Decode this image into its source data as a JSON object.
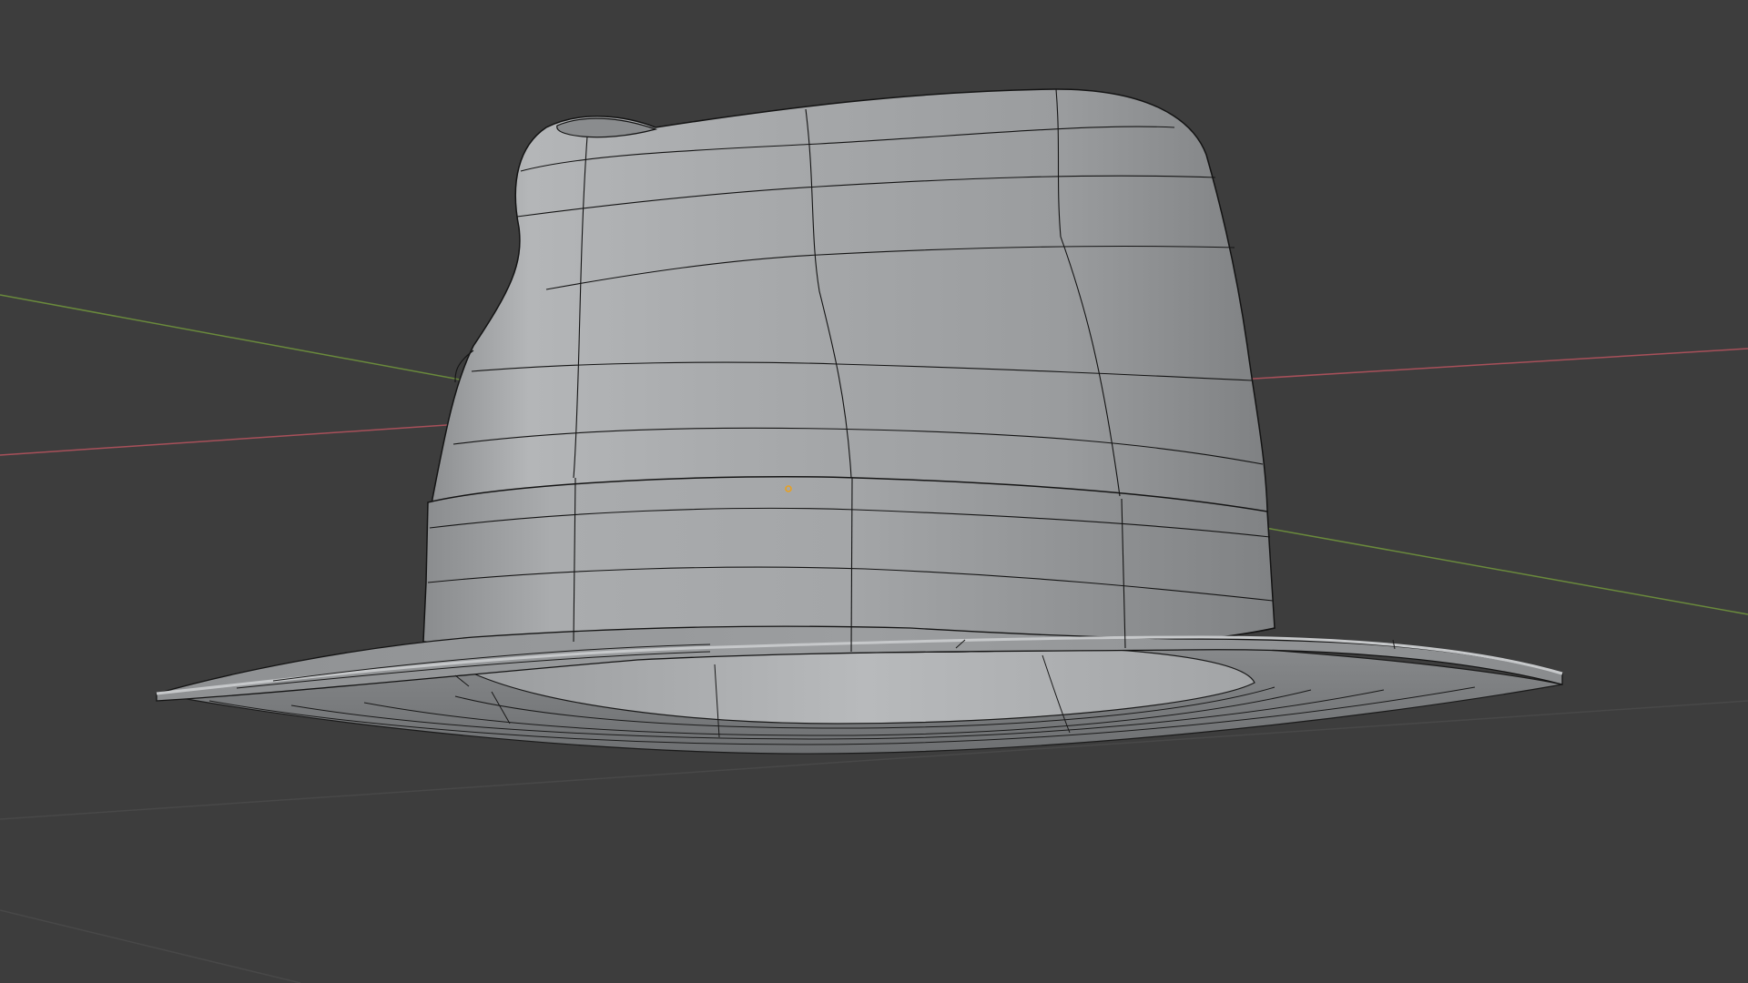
{
  "viewport": {
    "background": "#3d3d3d",
    "axis_x_color": "#b0525a",
    "axis_y_color": "#6a8a3c",
    "grid_color": "#4a4a4a",
    "mesh_color": "#a8aaac",
    "wire_color": "#141414",
    "origin_color": "#e8a020"
  },
  "scene": {
    "object_name": "hat",
    "shading": "solid",
    "overlay": "wireframe",
    "icon": "hat-mesh-icon"
  }
}
